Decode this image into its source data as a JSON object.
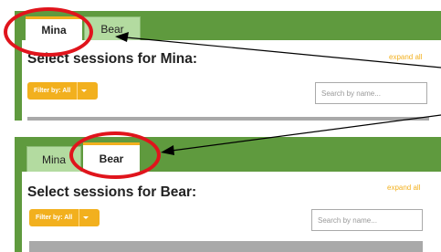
{
  "top": {
    "tabs": [
      {
        "label": "Mina"
      },
      {
        "label": "Bear"
      }
    ],
    "heading": "Select sessions for Mina:",
    "expand_all": "expand all",
    "filter_label": "Filter by: All",
    "search_placeholder": "Search by name..."
  },
  "bottom": {
    "tabs": [
      {
        "label": "Mina"
      },
      {
        "label": "Bear"
      }
    ],
    "heading": "Select sessions for Bear:",
    "expand_all": "expand all",
    "filter_label": "Filter by: All",
    "search_placeholder": "Search by name..."
  },
  "colors": {
    "panel_green": "#5f9a3e",
    "inactive_tab": "#b3dba0",
    "accent_orange": "#f2b01e",
    "annotation_red": "#e0141c"
  }
}
